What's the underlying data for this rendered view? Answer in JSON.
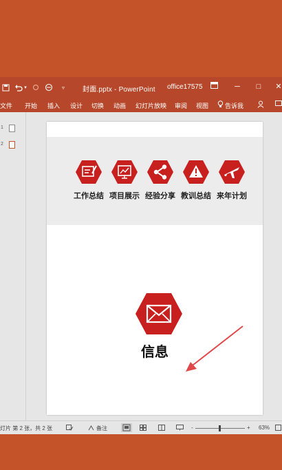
{
  "titlebar": {
    "doc_title": "封面.pptx  -  PowerPoint",
    "account": "office17575",
    "save_icon": "save-icon",
    "undo_icon": "undo-icon",
    "redo_icon": "redo-icon",
    "ribbon_display_icon": "ribbon-display-icon",
    "minimize": "─",
    "maximize": "□",
    "close": "✕"
  },
  "ribbon": {
    "tabs": [
      "文件",
      "开始",
      "插入",
      "设计",
      "切换",
      "动画",
      "幻灯片放映",
      "审阅",
      "视图"
    ],
    "tell_me": "告诉我",
    "share_icon": "share-icon"
  },
  "slide": {
    "items": [
      {
        "label": "工作总结",
        "icon": "document-edit-icon"
      },
      {
        "label": "项目展示",
        "icon": "presentation-board-icon"
      },
      {
        "label": "经验分享",
        "icon": "share-nodes-icon"
      },
      {
        "label": "教训总结",
        "icon": "warning-icon"
      },
      {
        "label": "来年计划",
        "icon": "airplane-icon"
      }
    ],
    "main_label": "信息",
    "main_icon": "envelope-icon",
    "accent_color": "#c8201e"
  },
  "thumbs": {
    "first": "1",
    "second": "2"
  },
  "statusbar": {
    "slide_info": "灯片 第 2 张，共 2 张",
    "notes": "备注",
    "zoom": "63%",
    "minus": "-",
    "plus": "+"
  }
}
